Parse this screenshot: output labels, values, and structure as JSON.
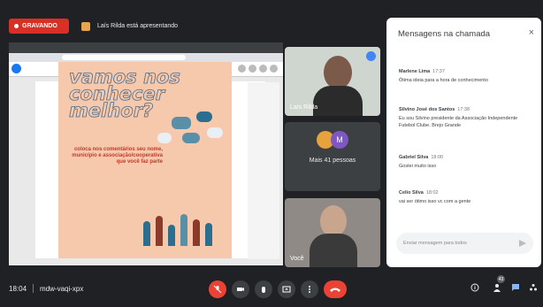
{
  "top": {
    "rec_label": "GRAVANDO",
    "presenting_text": "Laís Rilda está apresentando"
  },
  "share": {
    "post_title": "vamos nos conhecer melhor?",
    "post_subtitle": "coloca nos comentários seu nome, município e associação/cooperativa que você faz parte"
  },
  "tiles": {
    "presenter_name": "Laís Rilda",
    "more_avatar_letter": "M",
    "more_label": "Mais 41 pessoas",
    "self_name": "Você"
  },
  "panel": {
    "title": "Mensagens na chamada",
    "close": "×",
    "messages": [
      {
        "name": "Marlene Lima",
        "time": "17:37",
        "text": "Ótima ideia para a hora de conhecimento"
      },
      {
        "name": "Silvino José dos Santos",
        "time": "17:38",
        "text": "Eu sou Silvino presidente da Associação Independente Futebol Clube. Brejo Grande"
      },
      {
        "name": "Gabriel Silva",
        "time": "18:00",
        "text": "Gostei muito isso"
      },
      {
        "name": "Celio Silva",
        "time": "18:02",
        "text": "vai ser ótimo isso vc com a gente"
      }
    ],
    "input_placeholder": "Enviar mensagem para todos"
  },
  "bottom": {
    "time": "18:04",
    "meeting_code": "mdw-vaqi-xpx",
    "people_count": "43"
  },
  "colors": {
    "background": "#202124",
    "record_red": "#d93025",
    "hangup_red": "#ea4335",
    "accent_blue": "#1a73e8"
  },
  "icons": [
    "mic-off-icon",
    "camera-off-icon",
    "raise-hand-icon",
    "present-icon",
    "more-options-icon",
    "hang-up-icon",
    "info-icon",
    "people-icon",
    "chat-icon",
    "activities-icon",
    "close-icon",
    "send-icon"
  ]
}
